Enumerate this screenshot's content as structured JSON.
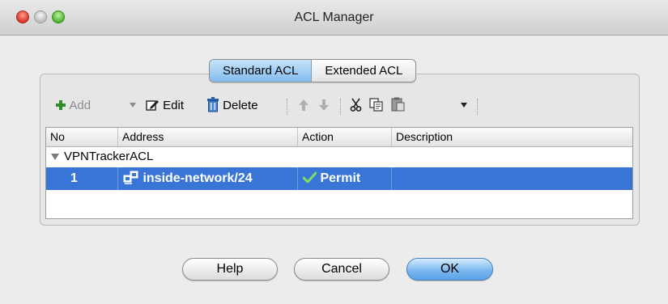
{
  "window": {
    "title": "ACL Manager"
  },
  "tabs": [
    {
      "label": "Standard ACL",
      "selected": true
    },
    {
      "label": "Extended ACL",
      "selected": false
    }
  ],
  "toolbar": {
    "add_label": "Add",
    "edit_label": "Edit",
    "delete_label": "Delete"
  },
  "table": {
    "columns": [
      "No",
      "Address",
      "Action",
      "Description"
    ],
    "group_name": "VPNTrackerACL",
    "rows": [
      {
        "no": "1",
        "address": "inside-network/24",
        "action": "Permit",
        "description": ""
      }
    ]
  },
  "buttons": {
    "help": "Help",
    "cancel": "Cancel",
    "ok": "OK"
  },
  "colors": {
    "selection": "#3875d7",
    "tab_selected": "#9fcdf4",
    "window_bg": "#ececec"
  }
}
